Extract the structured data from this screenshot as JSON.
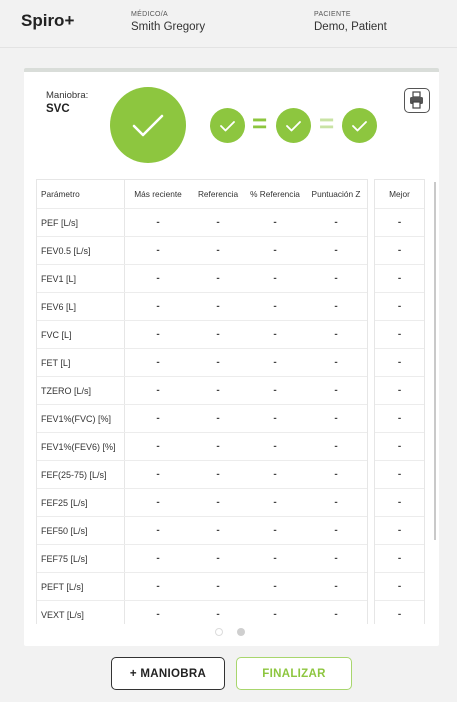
{
  "header": {
    "app_title": "Spiro+",
    "doctor_label": "MÉDICO/A",
    "doctor_name": "Smith Gregory",
    "patient_label": "PACIENTE",
    "patient_name": "Demo, Patient"
  },
  "maneuver": {
    "label": "Maniobra:",
    "value": "SVC",
    "equals": "="
  },
  "colors": {
    "accent_green": "#8dc63f",
    "light_green": "#c9e3a4"
  },
  "icons": {
    "print": "printer-icon",
    "check": "check-icon"
  },
  "table": {
    "headers": {
      "param": "Parámetro",
      "recent": "Más reciente",
      "ref": "Referencia",
      "pct": "% Referencia",
      "z": "Puntuación Z",
      "best": "Mejor"
    },
    "rows": [
      {
        "param": "PEF [L/s]",
        "recent": "-",
        "ref": "-",
        "pct": "-",
        "z": "-",
        "best": "-"
      },
      {
        "param": "FEV0.5 [L/s]",
        "recent": "-",
        "ref": "-",
        "pct": "-",
        "z": "-",
        "best": "-"
      },
      {
        "param": "FEV1 [L]",
        "recent": "-",
        "ref": "-",
        "pct": "-",
        "z": "-",
        "best": "-"
      },
      {
        "param": "FEV6 [L]",
        "recent": "-",
        "ref": "-",
        "pct": "-",
        "z": "-",
        "best": "-"
      },
      {
        "param": "FVC [L]",
        "recent": "-",
        "ref": "-",
        "pct": "-",
        "z": "-",
        "best": "-"
      },
      {
        "param": "FET [L]",
        "recent": "-",
        "ref": "-",
        "pct": "-",
        "z": "-",
        "best": "-"
      },
      {
        "param": "TZERO [L/s]",
        "recent": "-",
        "ref": "-",
        "pct": "-",
        "z": "-",
        "best": "-"
      },
      {
        "param": "FEV1%(FVC) [%]",
        "recent": "-",
        "ref": "-",
        "pct": "-",
        "z": "-",
        "best": "-"
      },
      {
        "param": "FEV1%(FEV6) [%]",
        "recent": "-",
        "ref": "-",
        "pct": "-",
        "z": "-",
        "best": "-"
      },
      {
        "param": "FEF(25-75) [L/s]",
        "recent": "-",
        "ref": "-",
        "pct": "-",
        "z": "-",
        "best": "-"
      },
      {
        "param": "FEF25 [L/s]",
        "recent": "-",
        "ref": "-",
        "pct": "-",
        "z": "-",
        "best": "-"
      },
      {
        "param": "FEF50 [L/s]",
        "recent": "-",
        "ref": "-",
        "pct": "-",
        "z": "-",
        "best": "-"
      },
      {
        "param": "FEF75 [L/s]",
        "recent": "-",
        "ref": "-",
        "pct": "-",
        "z": "-",
        "best": "-"
      },
      {
        "param": "PEFT [L/s]",
        "recent": "-",
        "ref": "-",
        "pct": "-",
        "z": "-",
        "best": "-"
      },
      {
        "param": "VEXT [L/s]",
        "recent": "-",
        "ref": "-",
        "pct": "-",
        "z": "-",
        "best": "-"
      }
    ]
  },
  "pagination": {
    "page_count": 2,
    "active_page": 2
  },
  "buttons": {
    "add_maneuver": "+ MANIOBRA",
    "finish": "FINALIZAR"
  }
}
